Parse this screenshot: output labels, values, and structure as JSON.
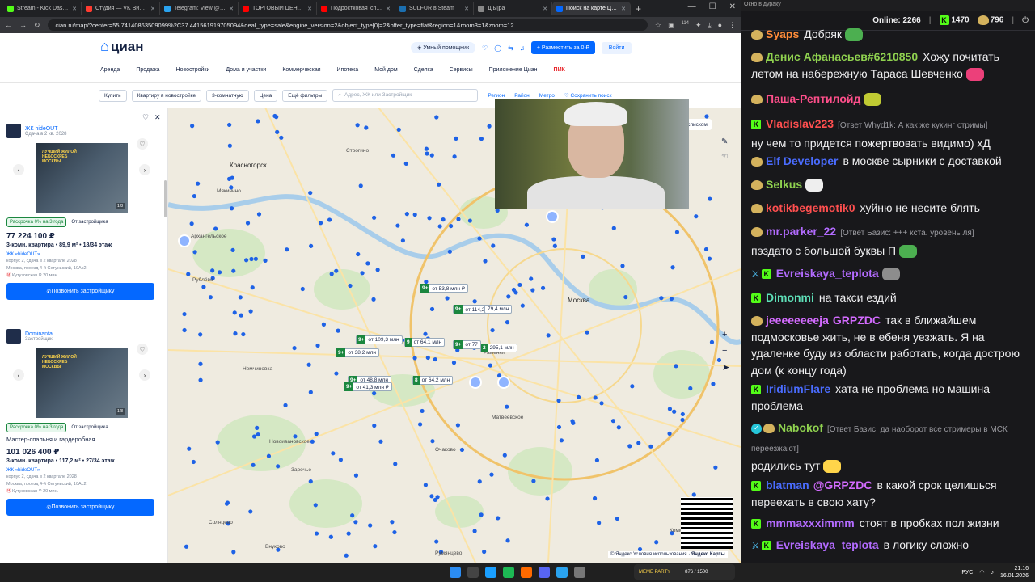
{
  "browser": {
    "tabs": [
      {
        "label": "Stream - Kick Dashboard",
        "color": "#53fc18",
        "active": false
      },
      {
        "label": "Студия — VK Видео Li...",
        "color": "#ff3b30",
        "active": false
      },
      {
        "label": "Telegram: View @arta...",
        "color": "#2aa3ef",
        "active": false
      },
      {
        "label": "ТОРГОВЫЙ ЦЕНТР СМ...",
        "color": "#ff0000",
        "active": false
      },
      {
        "label": "Подростковая 'списк...",
        "color": "#ff0000",
        "active": false
      },
      {
        "label": "SULFUR в Steam",
        "color": "#1b6fb0",
        "active": false
      },
      {
        "label": "Д[ы]ра",
        "color": "#888888",
        "active": false
      },
      {
        "label": "Поиск на карте Циан...",
        "color": "#0468ff",
        "active": true
      }
    ],
    "url": "cian.ru/map/?center=55.74140863509099%2C37.441561919705094&deal_type=sale&engine_version=2&object_type[0]=2&offer_type=flat&region=1&room3=1&zoom=12",
    "ext_count": "114"
  },
  "site": {
    "logo": "циан",
    "assistant": "Умный помощник",
    "post_ad": "+ Разместить за 0 ₽",
    "login": "Войти",
    "nav": [
      "Аренда",
      "Продажа",
      "Новостройки",
      "Дома и участки",
      "Коммерческая",
      "Ипотека",
      "Мой дом",
      "Сделка",
      "Сервисы",
      "Приложение Циан"
    ],
    "nav_pik": "ПИК",
    "filters": [
      "Купить",
      "Квартиру в новостройке",
      "3-комнатную",
      "Цена",
      "Ещё фильтры"
    ],
    "search_placeholder": "Адрес, ЖК или Застройщик",
    "filter_links": [
      "Регион",
      "Район",
      "Метро"
    ],
    "save_search": "Сохранить поиск"
  },
  "listings": [
    {
      "dev_name": "ЖК hideOUT",
      "dev_sub": "Сдача в 2 кв. 2028",
      "photo_text": "ЛУЧШИЙ ЖИЛОЙ НЕБОСКРЕБ МОСКВЫ",
      "photo_counter": "1/8",
      "tag1": "Рассрочка 0% на 3 года",
      "tag2": "От застройщика",
      "label": "",
      "price": "77 224 100 ₽",
      "rooms": "3-комн. квартира",
      "area": "89,9 м²",
      "floor": "18/34 этаж",
      "jk": "ЖК «hideOUT»",
      "meta1": "корпус 2, сдача в 2 квартале 2028",
      "meta2": "Москва, проезд 4-й Сетуньский, 10Ас2",
      "metro": "Кутузовская",
      "walk": "20 мин.",
      "call": "Позвонить застройщику"
    },
    {
      "dev_name": "Dominanta",
      "dev_sub": "Застройщик",
      "photo_text": "ЛУЧШИЙ ЖИЛОЙ НЕБОСКРЕБ МОСКВЫ",
      "photo_counter": "1/8",
      "tag1": "Рассрочка 0% на 3 года",
      "tag2": "От застройщика",
      "label": "Мастер-спальня и гардеробная",
      "price": "101 026 400 ₽",
      "rooms": "3-комн. квартира",
      "area": "117,2 м²",
      "floor": "27/34 этаж",
      "jk": "ЖК «hideOUT»",
      "meta1": "корпус 2, сдача в 2 квартале 2028",
      "meta2": "Москва, проезд 4-й Сетуньский, 10Ас2",
      "metro": "Кутузовская",
      "walk": "20 мин.",
      "call": "Позвонить застройщику"
    }
  ],
  "map": {
    "list_view": "7 610 объектов списком",
    "labels": [
      "Красногорск",
      "Москва",
      "Немчиновка",
      "Новоивановское",
      "Заречье",
      "Архангельское",
      "Рублёво",
      "Мякинино",
      "Строгино",
      "Очаково",
      "Матвеевское",
      "Солнцево",
      "Внуково",
      "Румянцево",
      "Коммунарка",
      "Раменки"
    ],
    "pins": [
      {
        "count": "9+",
        "price": "от 53,8 млн ₽"
      },
      {
        "count": "9+",
        "price": "от 114,2 млн ₽"
      },
      {
        "count": "",
        "price": "79,4 млн"
      },
      {
        "count": "9+",
        "price": "от 109,3 млн"
      },
      {
        "count": "9",
        "price": "от 64,1 млн"
      },
      {
        "count": "9+",
        "price": "от 77"
      },
      {
        "count": "2",
        "price": "295,1 млн"
      },
      {
        "count": "9+",
        "price": "от 38,2 млн"
      },
      {
        "count": "9+",
        "price": "от 48,8 млн"
      },
      {
        "count": "9+",
        "price": "от 41,3 млн ₽"
      },
      {
        "count": "8",
        "price": "от 64,2 млн"
      }
    ],
    "watermark": "Яндекс Карты",
    "terms": "© Яндекс Условия использования"
  },
  "chat": {
    "window_title": "Окно в дураку",
    "online_label": "Online:",
    "online": "2266",
    "kick_viewers": "1470",
    "other_viewers": "796",
    "messages": [
      {
        "user": "Syaps",
        "color": "#ff8c3a",
        "badge": "bird",
        "text": "Добряк",
        "reply": "",
        "emote": "#4caf50"
      },
      {
        "user": "Денис Афанасьев#6210850",
        "color": "#8fd14f",
        "badge": "bird",
        "text": "Хожу почитать летом на набережную Тараса Шевченко",
        "reply": "",
        "emote": "#ec407a"
      },
      {
        "user": "Паша-Рептилойд",
        "color": "#ff4f8b",
        "badge": "bird",
        "text": "",
        "reply": "",
        "emote": "#c0ca33"
      },
      {
        "user": "Vladislav223",
        "color": "#ff4f4f",
        "badge": "kick",
        "text": "ну чем то придется пожертвовать видимо) хД",
        "reply": "[Ответ Whyd1k: А как же кукинг стримы]",
        "emote": ""
      },
      {
        "user": "Elf Developer",
        "color": "#4a6cff",
        "badge": "bird",
        "text": "в москве сырники с доставкой",
        "reply": "",
        "emote": ""
      },
      {
        "user": "Selkus",
        "color": "#8fd14f",
        "badge": "bird",
        "text": "",
        "reply": "",
        "emote": "#eeeeee"
      },
      {
        "user": "kotikbegemotik0",
        "color": "#ff4f4f",
        "badge": "bird",
        "text": "хуйню не несите блять",
        "reply": "",
        "emote": ""
      },
      {
        "user": "mr.parker_22",
        "color": "#b36bff",
        "badge": "bird",
        "text": "пэздато с большой буквы П",
        "reply": "[Ответ Базис: +++ кста. уровень ля]",
        "emote": "#4caf50"
      },
      {
        "user": "Evreiskaya_teplota",
        "color": "#b36bff",
        "badge": "sword-kick",
        "text": "",
        "reply": "",
        "emote": "#8d8d8d"
      },
      {
        "user": "Dimonmi",
        "color": "#5ee0b8",
        "badge": "kick",
        "text": "на такси ездий",
        "reply": "",
        "emote": ""
      },
      {
        "user": "jeeeeeeeeja",
        "color": "#d36bff",
        "badge": "bird",
        "text": "так в ближайшем подмосковье жить, не в ебеня уезжать. Я на удаленке буду из области работать, когда дострою дом (к концу года)",
        "reply": "",
        "mention": "GRPZDC",
        "emote": ""
      },
      {
        "user": "IridiumFlare",
        "color": "#4a6cff",
        "badge": "kick",
        "text": "хата не проблема но машина проблема",
        "reply": "",
        "emote": ""
      },
      {
        "user": "Nabokof",
        "color": "#8fd14f",
        "badge": "verified-bird",
        "text": "родились тут",
        "reply": "[Ответ Базис: да наоборот все стримеры в МСК переезжают]",
        "emote": "#ffd54a"
      },
      {
        "user": "blatman",
        "color": "#4a6cff",
        "badge": "kick",
        "text": "в какой срок целишься переехать в свою хату?",
        "reply": "",
        "mention": "@GRPZDC",
        "emote": ""
      },
      {
        "user": "mmmaxxximmm",
        "color": "#b36bff",
        "badge": "kick",
        "text": "стоят в пробках пол жизни",
        "reply": "",
        "emote": ""
      },
      {
        "user": "Evreiskaya_teplota",
        "color": "#b36bff",
        "badge": "sword-kick",
        "text": "в логику сложно",
        "reply": "",
        "emote": ""
      }
    ]
  },
  "taskbar": {
    "meme_label": "MEME PARTY",
    "meme_count": "876 / 1500",
    "lang": "РУС",
    "time": "21:16",
    "date": "16.01.2026"
  },
  "colors": {
    "cian_blue": "#0468ff",
    "cian_navy": "#152242",
    "kick_green": "#53fc18",
    "chat_bg": "#18181b",
    "map_pin": "#1e62e6"
  }
}
